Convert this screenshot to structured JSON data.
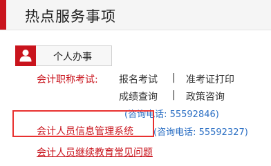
{
  "header": {
    "title": "热点服务事项"
  },
  "section": {
    "label": "个人办事",
    "icon": "user-icon"
  },
  "exam": {
    "label": "会计职称考试:",
    "links": [
      "报名考试",
      "准考证打印",
      "成绩查询",
      "政策咨询"
    ],
    "separator": "|",
    "phone": "(咨询电话: 55592846)"
  },
  "info_system": {
    "label": "会计人员信息管理系统",
    "phone": "(咨询电话: 55592327)"
  },
  "faq": {
    "label": "会计人员继续教育常见问题"
  },
  "colors": {
    "accent": "#c9141d",
    "phone": "#2b6fc4",
    "highlight": "#e8302f"
  }
}
